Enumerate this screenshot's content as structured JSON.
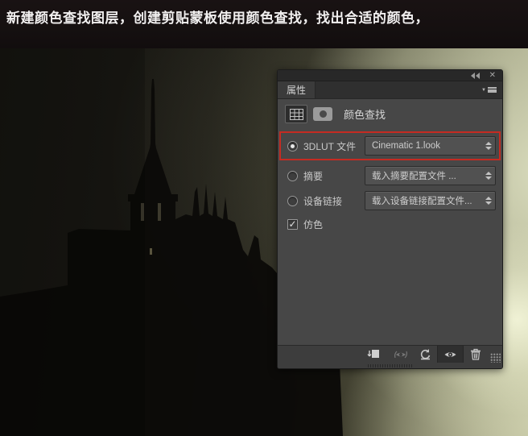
{
  "caption": {
    "text": "新建颜色查找图层，创建剪贴蒙板使用颜色查找，找出合适的颜色，"
  },
  "panel": {
    "tab_label": "属性",
    "title": "颜色查找",
    "highlight_color": "#c52b22",
    "rows": [
      {
        "type": "radio",
        "label": "3DLUT 文件",
        "value": "Cinematic 1.look",
        "selected": true,
        "highlighted": true
      },
      {
        "type": "radio",
        "label": "摘要",
        "value": "载入摘要配置文件 ...",
        "selected": false
      },
      {
        "type": "radio",
        "label": "设备链接",
        "value": "载入设备链接配置文件...",
        "selected": false
      },
      {
        "type": "checkbox",
        "label": "仿色",
        "checked": true
      }
    ],
    "toolbar_buttons": [
      "clip-to-layer",
      "toggle-previous-state",
      "reset",
      "toggle-visibility",
      "delete"
    ]
  },
  "icons": {
    "close": "✕",
    "panel_menu_arrow": "▼",
    "check": "✓"
  }
}
